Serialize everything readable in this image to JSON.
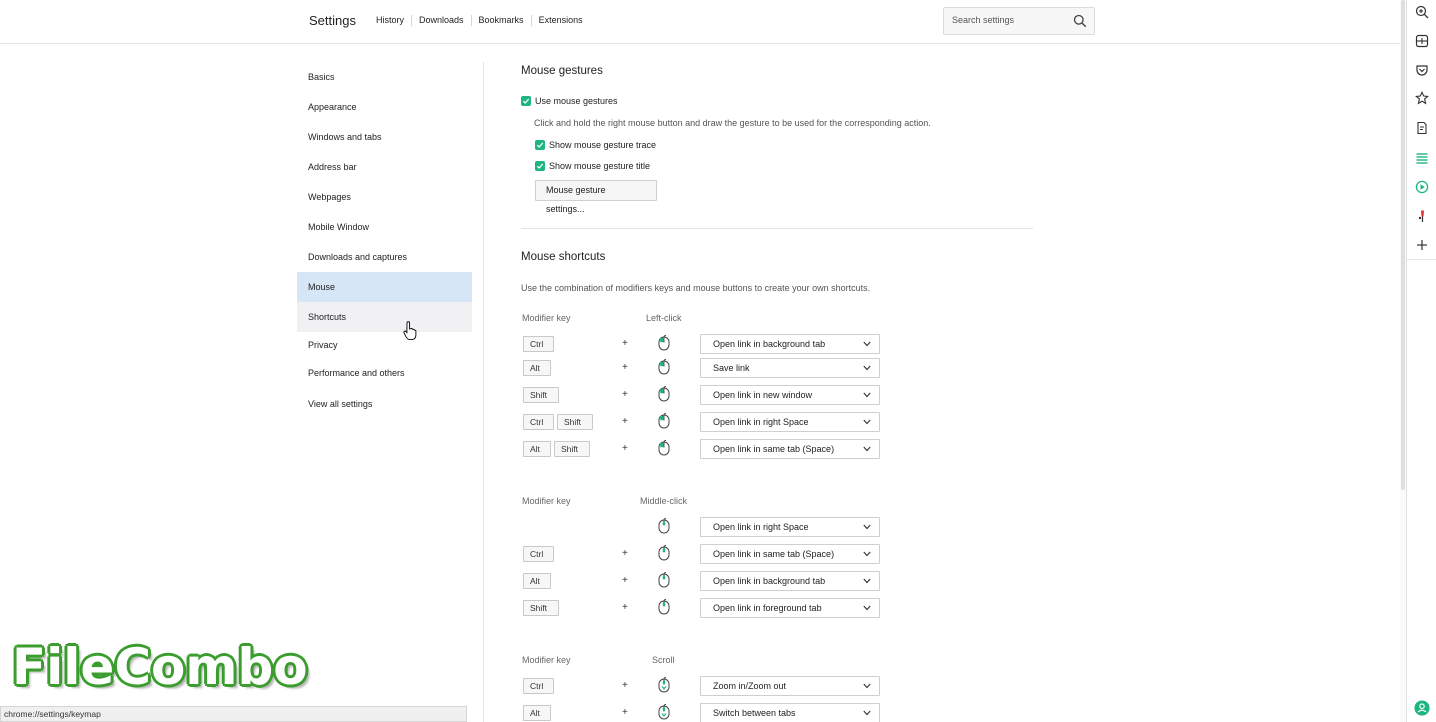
{
  "header": {
    "title": "Settings",
    "nav": [
      "History",
      "Downloads",
      "Bookmarks",
      "Extensions"
    ],
    "search_placeholder": "Search settings"
  },
  "sidebar": {
    "items": [
      "Basics",
      "Appearance",
      "Windows and tabs",
      "Address bar",
      "Webpages",
      "Mobile Window",
      "Downloads and captures",
      "Mouse",
      "Shortcuts",
      "Privacy",
      "Performance and others",
      "View all settings"
    ],
    "active": "Mouse",
    "hovered": "Shortcuts"
  },
  "gestures": {
    "heading": "Mouse gestures",
    "use_label": "Use mouse gestures",
    "use_checked": true,
    "description": "Click and hold the right mouse button and draw the gesture to be used for the corresponding action.",
    "trace_label": "Show mouse gesture trace",
    "trace_checked": true,
    "title_label": "Show mouse gesture title",
    "title_checked": true,
    "settings_button": "Mouse gesture settings..."
  },
  "shortcuts": {
    "heading": "Mouse shortcuts",
    "description": "Use the combination of modifiers keys and mouse buttons to create your own shortcuts.",
    "modifier_header": "Modifier key",
    "plus": "+",
    "left_click": {
      "header": "Left-click",
      "rows": [
        {
          "keys": [
            "Ctrl"
          ],
          "action": "Open link in background tab"
        },
        {
          "keys": [
            "Alt"
          ],
          "action": "Save link"
        },
        {
          "keys": [
            "Shift"
          ],
          "action": "Open link in new window"
        },
        {
          "keys": [
            "Ctrl",
            "Shift"
          ],
          "action": "Open link in right Space"
        },
        {
          "keys": [
            "Alt",
            "Shift"
          ],
          "action": "Open link in same tab (Space)"
        }
      ]
    },
    "middle_click": {
      "header": "Middle-click",
      "rows": [
        {
          "keys": [],
          "action": "Open link in right Space"
        },
        {
          "keys": [
            "Ctrl"
          ],
          "action": "Open link in same tab (Space)"
        },
        {
          "keys": [
            "Alt"
          ],
          "action": "Open link in background tab"
        },
        {
          "keys": [
            "Shift"
          ],
          "action": "Open link in foreground tab"
        }
      ]
    },
    "scroll": {
      "header": "Scroll",
      "rows": [
        {
          "keys": [
            "Ctrl"
          ],
          "action": "Zoom in/Zoom out"
        },
        {
          "keys": [
            "Alt"
          ],
          "action": "Switch between tabs"
        }
      ]
    }
  },
  "status_url": "chrome://settings/keymap",
  "watermark": "FileCombo",
  "right_sidebar_icons": [
    "zoom-icon",
    "split-screen-icon",
    "pocket-icon",
    "star-icon",
    "notes-icon",
    "list-icon",
    "play-icon",
    "pin-icon",
    "plus-icon",
    "account-icon"
  ],
  "colors": {
    "accent_green": "#1fb57e",
    "active_nav": "#d6e6f7"
  }
}
